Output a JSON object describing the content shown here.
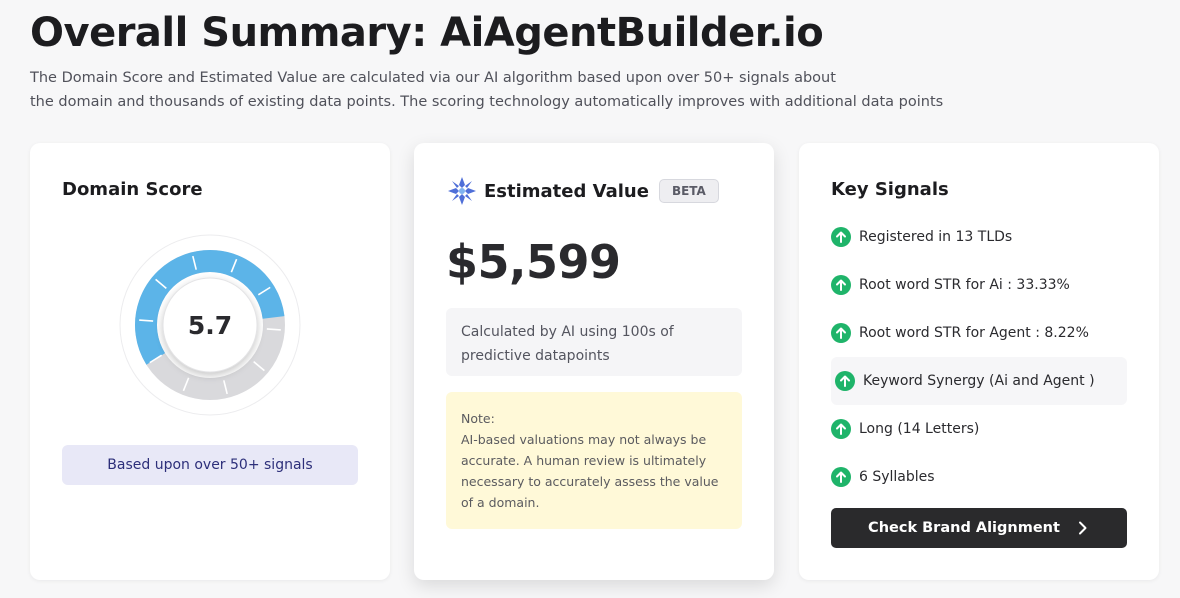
{
  "header": {
    "title": "Overall Summary: AiAgentBuilder.io",
    "description_line1": "The Domain Score and Estimated Value are calculated via our AI algorithm based upon over 50+ signals about",
    "description_line2": "the domain and thousands of existing data points. The scoring technology automatically improves with additional data points"
  },
  "domain_score": {
    "title": "Domain Score",
    "score": "5.7",
    "score_fraction": 0.57,
    "note": "Based upon over 50+ signals",
    "accent_color": "#5cb4e8"
  },
  "estimated_value": {
    "title": "Estimated Value",
    "badge": "BETA",
    "amount": "$5,599",
    "calc_text": "Calculated by AI using 100s of predictive datapoints",
    "note_label": "Note:",
    "note_text": "AI-based valuations may not always be accurate. A human review is ultimately necessary to accurately assess the value of a domain.",
    "icon": "ai-sparkle-icon",
    "icon_color": "#4f6fd8"
  },
  "key_signals": {
    "title": "Key Signals",
    "items": [
      {
        "label": "Registered in 13 TLDs"
      },
      {
        "label": "Root word STR for Ai : 33.33%"
      },
      {
        "label": "Root word STR for Agent : 8.22%"
      },
      {
        "label": "Keyword Synergy (Ai and Agent )"
      },
      {
        "label": "Long (14 Letters)"
      },
      {
        "label": "6 Syllables"
      }
    ],
    "icon_color": "#1fb46a",
    "button_label": "Check Brand Alignment"
  }
}
